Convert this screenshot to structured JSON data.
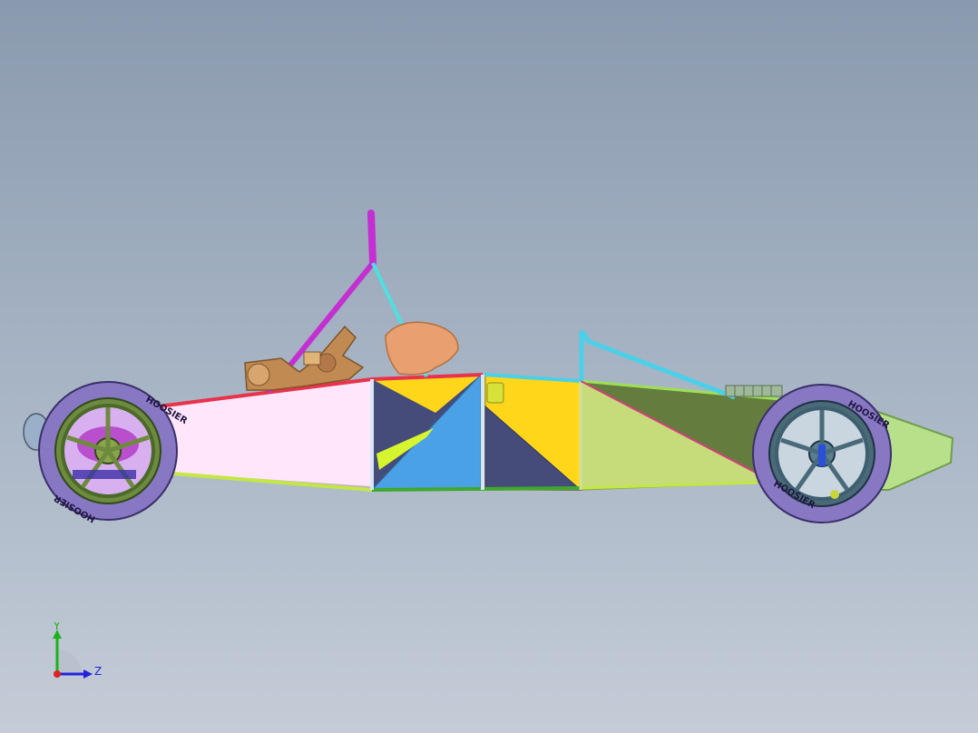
{
  "viewport": {
    "background_top": "#8a9aae",
    "background_bottom": "#c4ccd7"
  },
  "model": {
    "tire_brand_text": "HOOSIER"
  },
  "triad": {
    "y_label": "Y",
    "z_label": "Z",
    "y_color": "#19b319",
    "z_color": "#2222dd",
    "x_color": "#dd2222"
  }
}
